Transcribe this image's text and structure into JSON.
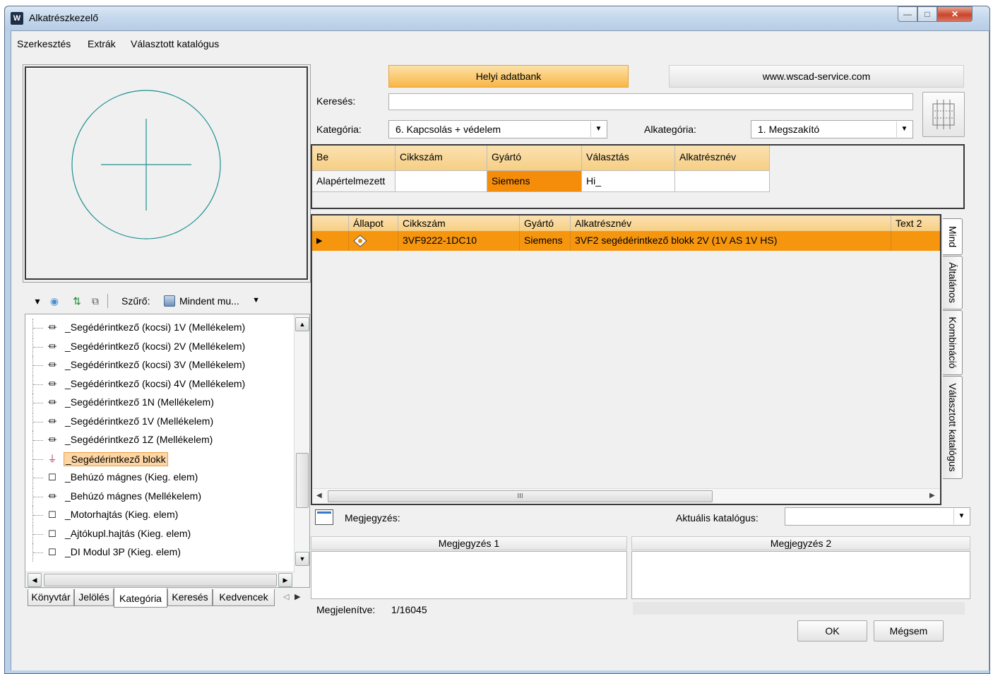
{
  "window": {
    "title": "Alkatrészkezelő",
    "app_icon": "W",
    "controls": {
      "minimize": "—",
      "maximize": "□",
      "close": "✕"
    }
  },
  "menu": [
    "Szerkesztés",
    "Extrák",
    "Választott katalógus"
  ],
  "tree_toolbar": {
    "filter_label": "Szűrő:",
    "filter_value": "Mindent mu..."
  },
  "tree": {
    "items": [
      {
        "label": "_Segédérintkező (kocsi) 1V (Mellékelem)",
        "icon": "component-icon"
      },
      {
        "label": "_Segédérintkező (kocsi) 2V (Mellékelem)",
        "icon": "component-icon"
      },
      {
        "label": "_Segédérintkező (kocsi) 3V (Mellékelem)",
        "icon": "component-icon"
      },
      {
        "label": "_Segédérintkező (kocsi) 4V (Mellékelem)",
        "icon": "component-icon"
      },
      {
        "label": "_Segédérintkező 1N (Mellékelem)",
        "icon": "component-icon"
      },
      {
        "label": "_Segédérintkező 1V (Mellékelem)",
        "icon": "component-icon"
      },
      {
        "label": "_Segédérintkező 1Z (Mellékelem)",
        "icon": "component-icon"
      },
      {
        "label": "_Segédérintkező blokk",
        "icon": "component-main-icon",
        "selected": true
      },
      {
        "label": "_Behúzó mágnes (Kieg. elem)",
        "icon": "box-icon"
      },
      {
        "label": "_Behúzó mágnes (Mellékelem)",
        "icon": "component-icon"
      },
      {
        "label": "_Motorhajtás (Kieg. elem)",
        "icon": "box-icon"
      },
      {
        "label": "_Ajtókupl.hajtás (Kieg. elem)",
        "icon": "box-icon"
      },
      {
        "label": "_DI Modul 3P (Kieg. elem)",
        "icon": "box-icon"
      }
    ]
  },
  "left_tabs": [
    "Könyvtár",
    "Jelölés",
    "Kategória",
    "Keresés",
    "Kedvencek"
  ],
  "left_tabs_active": "Kategória",
  "header_buttons": {
    "local_db": "Helyi adatbank",
    "service": "www.wscad-service.com"
  },
  "search": {
    "label": "Keresés:",
    "value": ""
  },
  "category": {
    "label": "Kategória:",
    "value": "6. Kapcsolás + védelem"
  },
  "subcategory": {
    "label": "Alkategória:",
    "value": "1. Megszakító"
  },
  "filter_grid": {
    "headers": [
      "Be",
      "Cikkszám",
      "Gyártó",
      "Választás",
      "Alkatrésznév"
    ],
    "row": [
      "Alapértelmezett",
      "",
      "Siemens",
      "Hi_",
      ""
    ]
  },
  "results": {
    "headers": [
      "",
      "Állapot",
      "Cikkszám",
      "Gyártó",
      "Alkatrésznév",
      "Text 2"
    ],
    "rows": [
      {
        "marker": "▶",
        "status_icon": "status-icon",
        "cikkszam": "3VF9222-1DC10",
        "gyarto": "Siemens",
        "nev": "3VF2 segédérintkező blokk 2V (1V AS 1V HS)",
        "text2": ""
      }
    ],
    "scroll_mid": "III"
  },
  "vertical_tabs": [
    "Mind",
    "Általános",
    "Kombináció",
    "Választott katalógus"
  ],
  "notes": {
    "label": "Megjegyzés:",
    "catalog_label": "Aktuális katalógus:",
    "catalog_value": "",
    "note1": "Megjegyzés 1",
    "note2": "Megjegyzés 2"
  },
  "status": {
    "label": "Megjelenítve:",
    "value": "1/16045"
  },
  "buttons": {
    "ok": "OK",
    "cancel": "Mégsem"
  },
  "colors": {
    "accent_orange": "#f6960f",
    "header_orange": "#f8b646",
    "selection_bg": "#fdd6a3"
  }
}
